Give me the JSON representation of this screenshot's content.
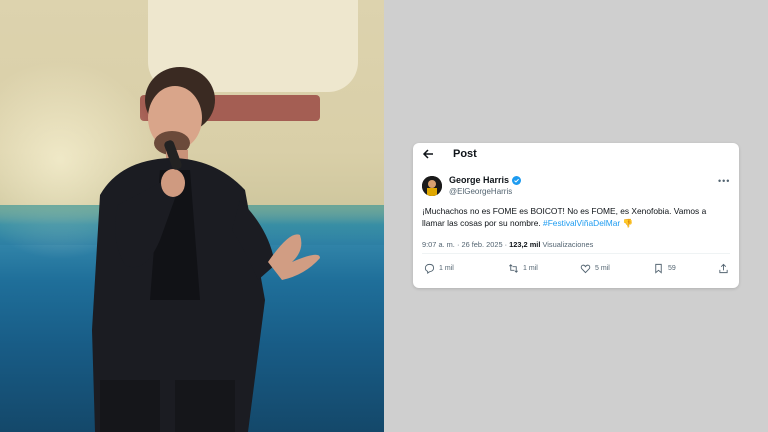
{
  "tweet": {
    "header_title": "Post",
    "author_name": "George Harris",
    "author_handle": "@ElGeorgeHarris",
    "body_text": "¡Muchachos no es FOME es BOICOT! No es FOME, es Xenofobia. Vamos a llamar las cosas por su nombre. ",
    "hashtag": "#FestivalViñaDelMar",
    "emoji": "👎",
    "time": "9:07 a. m.",
    "separator": "·",
    "date": "26 feb. 2025",
    "views_count": "123,2 mil",
    "views_label": "Visualizaciones",
    "replies": "1 mil",
    "reposts": "1 mil",
    "likes": "5 mil",
    "bookmarks": "59"
  },
  "icons": [
    "back-arrow-icon",
    "verified-badge-icon",
    "more-icon",
    "reply-icon",
    "repost-icon",
    "like-icon",
    "bookmark-icon",
    "share-icon"
  ],
  "colors": {
    "accent": "#1d9bf0",
    "text": "#0f1419",
    "muted": "#536471"
  }
}
